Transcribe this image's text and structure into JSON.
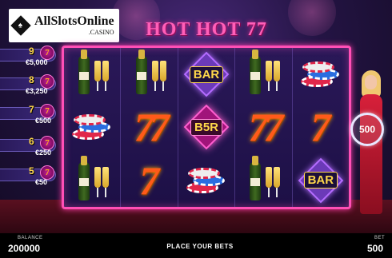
{
  "brand": {
    "icon": "spade-diamond-icon",
    "name": "AllSlotsOnline",
    "suffix": ".CASINO"
  },
  "game": {
    "title": "HOT HOT 77"
  },
  "paytable": [
    {
      "count": "9",
      "amount": "€5,000"
    },
    {
      "count": "8",
      "amount": "€3,250"
    },
    {
      "count": "7",
      "amount": "€500"
    },
    {
      "count": "6",
      "amount": "€250"
    },
    {
      "count": "5",
      "amount": "€50"
    }
  ],
  "reels": [
    [
      "champagne",
      "chips",
      "champagne"
    ],
    [
      "champagne",
      "double-seven",
      "seven"
    ],
    [
      "bar",
      "b5r",
      "chips"
    ],
    [
      "champagne",
      "double-seven",
      "champagne"
    ],
    [
      "chips",
      "seven",
      "bar"
    ]
  ],
  "symbols": {
    "bar_label": "BAR",
    "b5r_label": "B5R",
    "seven_glyph": "7",
    "double_seven_glyph": "77"
  },
  "spin": {
    "label": "500",
    "icon": "spin-arrows-icon"
  },
  "footer": {
    "balance_label": "BALANCE",
    "balance_value": "200000",
    "status_text": "PLACE YOUR BETS",
    "bet_label": "BET",
    "bet_value": "500"
  },
  "colors": {
    "frame": "#ff4fb6",
    "seven": "#ff5a1a",
    "bar_text": "#ffd84a",
    "background": "#241444"
  }
}
